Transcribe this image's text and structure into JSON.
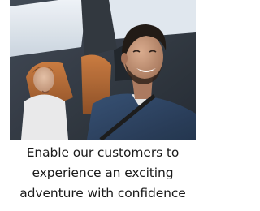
{
  "card": {
    "image_description": "photo-driver-smiling-in-car-with-passenger",
    "caption_lines": [
      "Enable our customers to",
      "experience an exciting",
      "adventure with confidence"
    ]
  },
  "colors": {
    "caption_text": "#1a1a1a",
    "background": "#ffffff"
  }
}
